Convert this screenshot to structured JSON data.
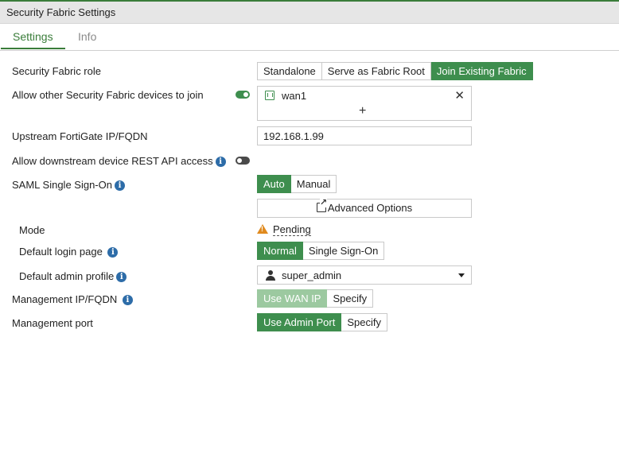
{
  "window": {
    "title": "Security Fabric Settings"
  },
  "tabs": [
    {
      "label": "Settings",
      "active": true
    },
    {
      "label": "Info",
      "active": false
    }
  ],
  "form": {
    "fabric_role": {
      "label": "Security Fabric role",
      "options": [
        "Standalone",
        "Serve as Fabric Root",
        "Join Existing Fabric"
      ],
      "selected": "Join Existing Fabric"
    },
    "allow_devices_join": {
      "label": "Allow other Security Fabric devices to join",
      "enabled": true,
      "interfaces": [
        "wan1"
      ],
      "add_symbol": "+",
      "remove_symbol": "✕"
    },
    "upstream": {
      "label": "Upstream FortiGate IP/FQDN",
      "value": "192.168.1.99"
    },
    "rest_api": {
      "label": "Allow downstream device REST API access",
      "enabled": false
    },
    "saml": {
      "label": "SAML Single Sign-On",
      "options": [
        "Auto",
        "Manual"
      ],
      "selected": "Auto",
      "advanced_button": "Advanced Options"
    },
    "mode": {
      "label": "Mode",
      "value": "Pending",
      "status_color": "#e08a1e"
    },
    "login_page": {
      "label": "Default login page",
      "options": [
        "Normal",
        "Single Sign-On"
      ],
      "selected": "Normal"
    },
    "admin_profile": {
      "label": "Default admin profile",
      "value": "super_admin"
    },
    "mgmt_ip": {
      "label": "Management IP/FQDN",
      "options": [
        "Use WAN IP",
        "Specify"
      ],
      "selected": "Use WAN IP"
    },
    "mgmt_port": {
      "label": "Management port",
      "options": [
        "Use Admin Port",
        "Specify"
      ],
      "selected": "Use Admin Port"
    }
  },
  "colors": {
    "accent": "#3e8e4e",
    "accent_disabled": "#9cc9a0",
    "info_icon": "#2d6ca8"
  }
}
